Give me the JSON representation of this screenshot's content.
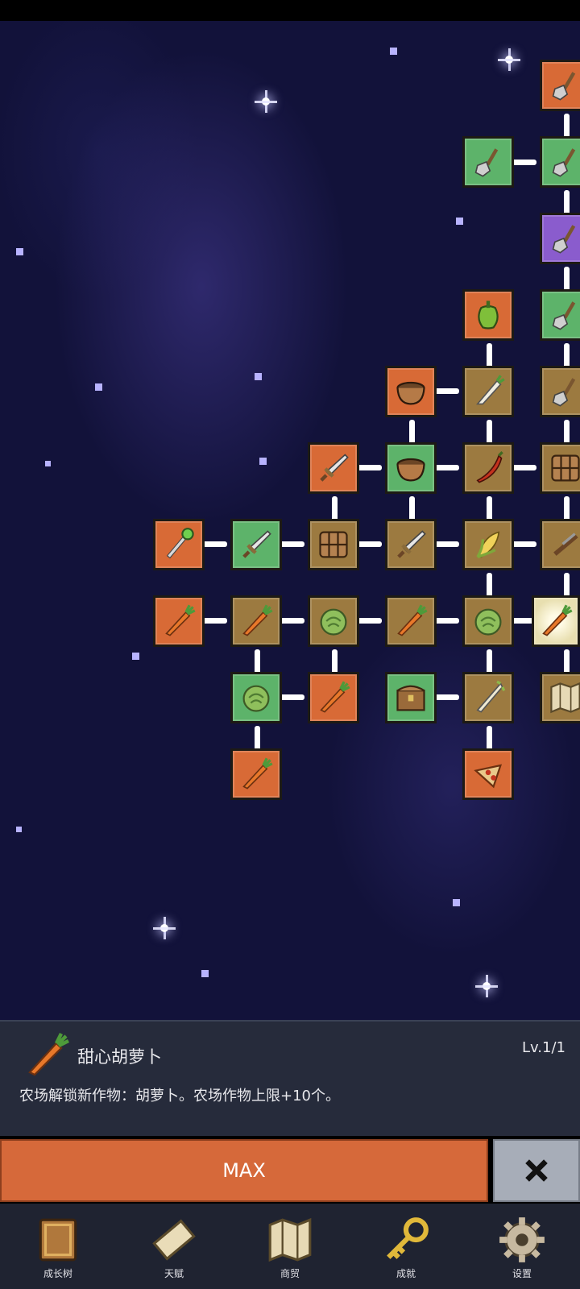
{
  "skill_tree": {
    "nodes": [
      {
        "icon": "shovel-icon",
        "color": "orange"
      },
      {
        "icon": "shovel-icon",
        "color": "green"
      },
      {
        "icon": "shovel-icon",
        "color": "green"
      },
      {
        "icon": "shovel-icon",
        "color": "purple"
      },
      {
        "icon": "bell-pepper-icon",
        "color": "orange"
      },
      {
        "icon": "shovel-icon",
        "color": "green"
      },
      {
        "icon": "bowl-icon",
        "color": "orange"
      },
      {
        "icon": "radish-icon",
        "color": "brown"
      },
      {
        "icon": "shovel-icon",
        "color": "brown"
      },
      {
        "icon": "sword-icon",
        "color": "orange"
      },
      {
        "icon": "bowl-icon",
        "color": "green"
      },
      {
        "icon": "chili-icon",
        "color": "brown"
      },
      {
        "icon": "crate-icon",
        "color": "brown"
      },
      {
        "icon": "staff-icon",
        "color": "orange"
      },
      {
        "icon": "sword-icon",
        "color": "green"
      },
      {
        "icon": "crate-icon",
        "color": "brown"
      },
      {
        "icon": "sword-icon",
        "color": "brown"
      },
      {
        "icon": "corn-icon",
        "color": "brown"
      },
      {
        "icon": "rifle-icon",
        "color": "brown"
      },
      {
        "icon": "carrot-icon",
        "color": "orange"
      },
      {
        "icon": "carrot-icon",
        "color": "brown"
      },
      {
        "icon": "cabbage-icon",
        "color": "brown"
      },
      {
        "icon": "carrot-icon",
        "color": "brown"
      },
      {
        "icon": "cabbage-icon",
        "color": "brown"
      },
      {
        "icon": "carrot-icon",
        "color": "glow"
      },
      {
        "icon": "cabbage-icon",
        "color": "green"
      },
      {
        "icon": "carrot-icon",
        "color": "orange"
      },
      {
        "icon": "treasure-chest-icon",
        "color": "green"
      },
      {
        "icon": "leek-icon",
        "color": "brown"
      },
      {
        "icon": "map-icon",
        "color": "brown"
      },
      {
        "icon": "carrot-icon",
        "color": "orange"
      },
      {
        "icon": "pizza-icon",
        "color": "orange"
      }
    ]
  },
  "detail": {
    "icon": "carrot-icon",
    "title": "甜心胡萝卜",
    "level": "Lv.1/1",
    "description": "农场解锁新作物：胡萝卜。农场作物上限+10个。"
  },
  "actions": {
    "max_label": "MAX",
    "close_icon": "close-icon"
  },
  "tabs": [
    {
      "label": "成长树",
      "icon": "book-icon"
    },
    {
      "label": "天赋",
      "icon": "scroll-icon"
    },
    {
      "label": "商贸",
      "icon": "map-icon"
    },
    {
      "label": "成就",
      "icon": "key-icon"
    },
    {
      "label": "设置",
      "icon": "gear-icon"
    }
  ],
  "colors": {
    "orange": "#d86a36",
    "green": "#5db36a",
    "brown": "#9c7a40",
    "purple": "#8a5ccd",
    "panel": "#262b3b",
    "max_button": "#d6693a",
    "close_button": "#a7adb8"
  }
}
